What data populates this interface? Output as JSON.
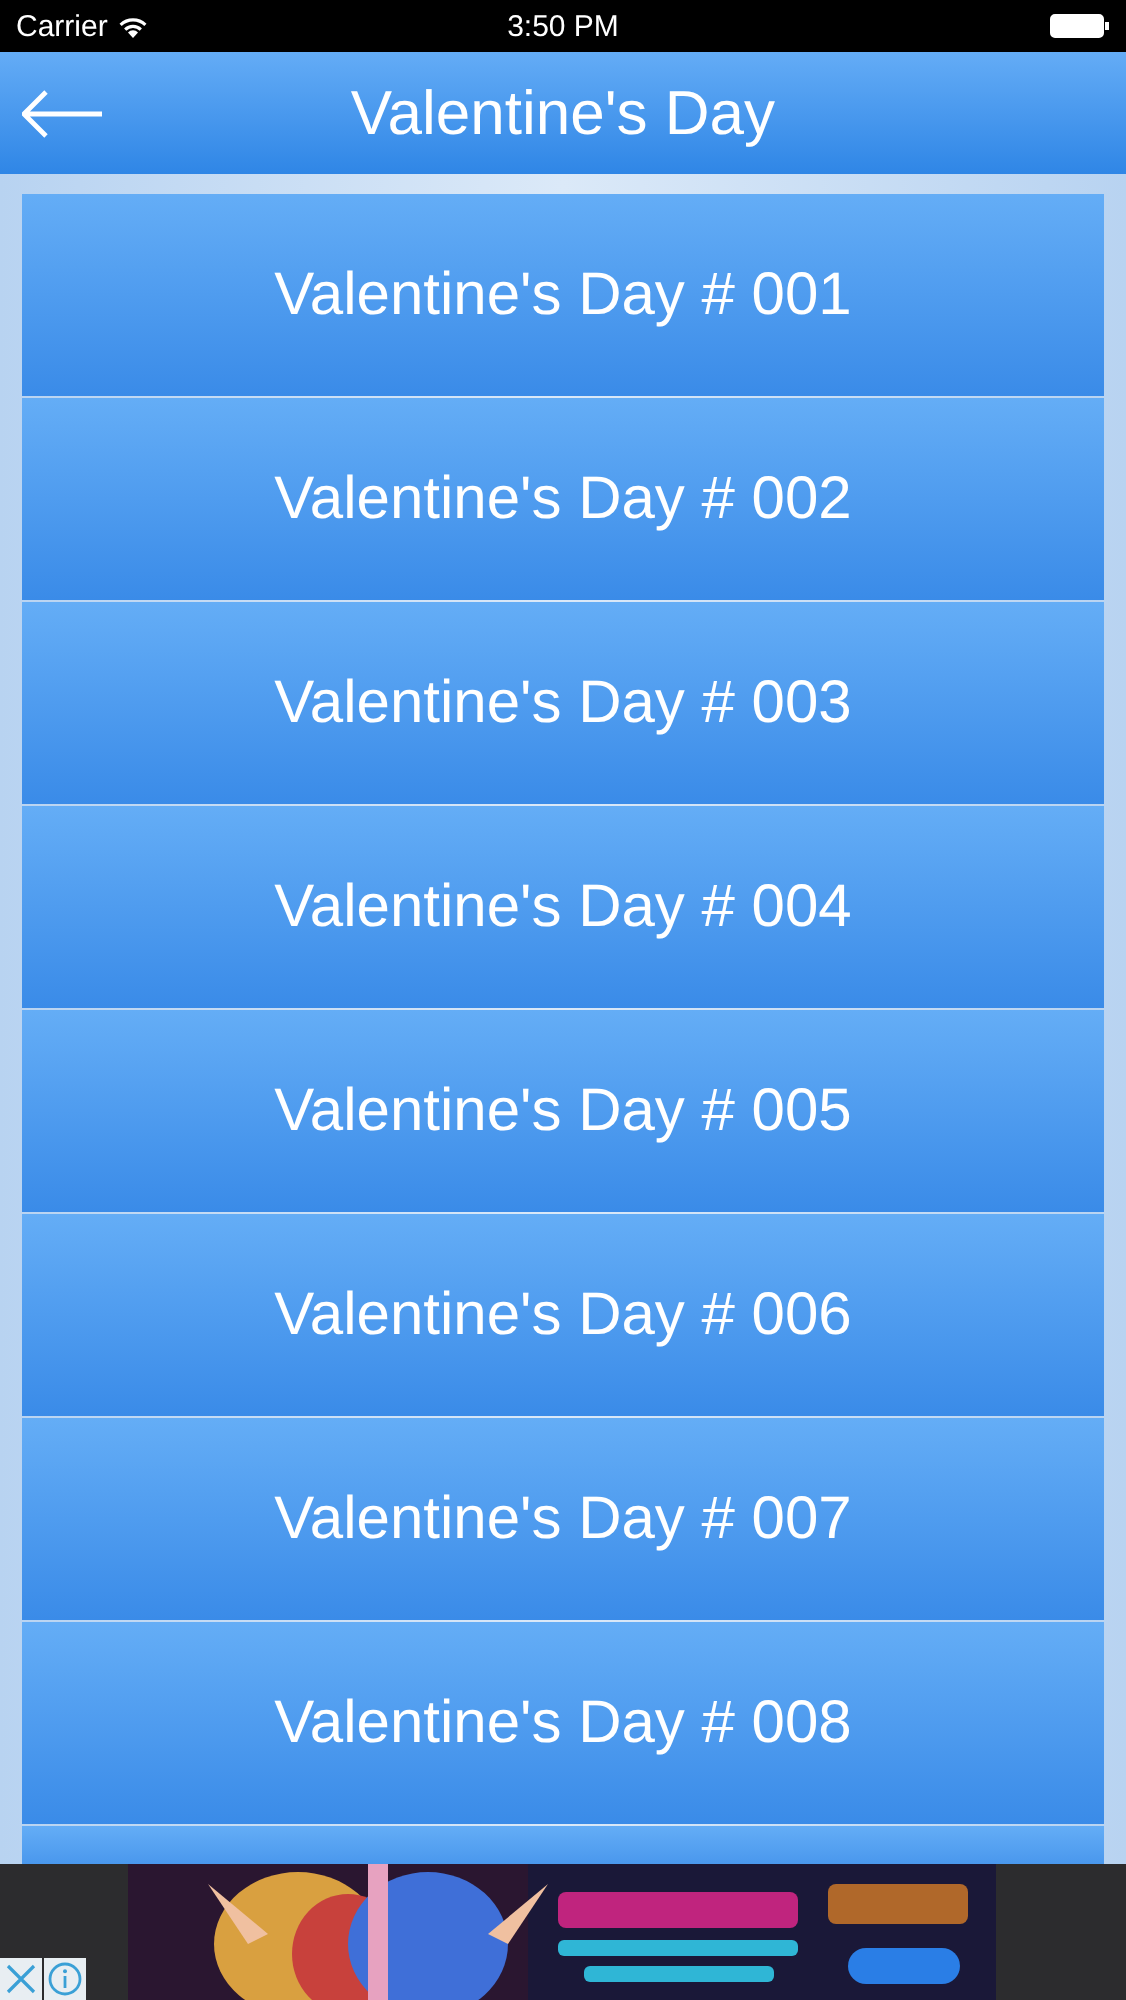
{
  "status_bar": {
    "carrier": "Carrier",
    "time": "3:50 PM"
  },
  "header": {
    "title": "Valentine's Day"
  },
  "items": [
    {
      "label": "Valentine's Day # 001"
    },
    {
      "label": "Valentine's Day # 002"
    },
    {
      "label": "Valentine's Day # 003"
    },
    {
      "label": "Valentine's Day # 004"
    },
    {
      "label": "Valentine's Day # 005"
    },
    {
      "label": "Valentine's Day # 006"
    },
    {
      "label": "Valentine's Day # 007"
    },
    {
      "label": "Valentine's Day # 008"
    }
  ]
}
